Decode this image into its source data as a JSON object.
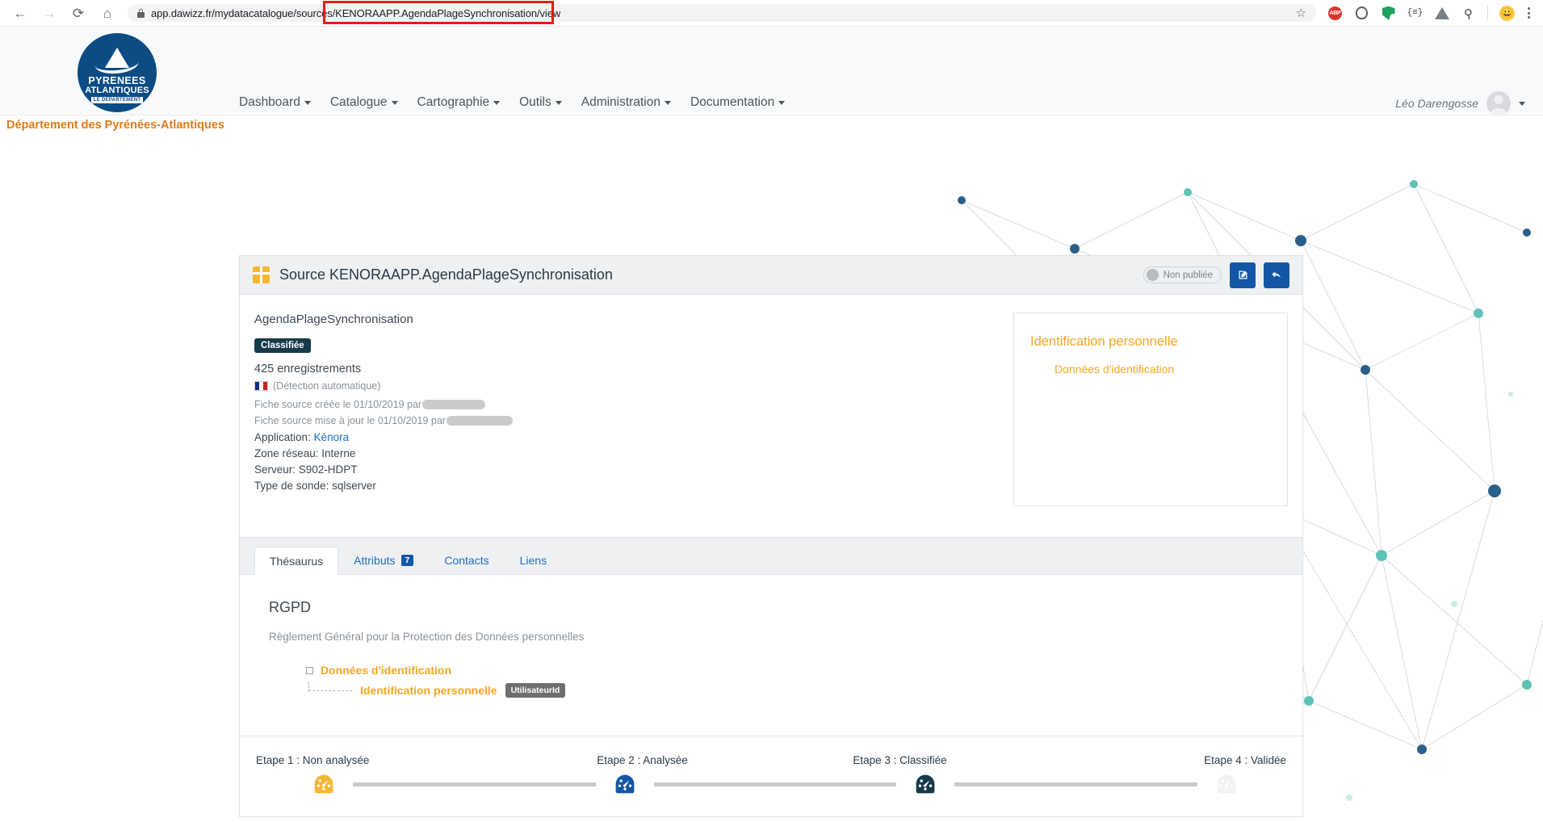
{
  "browser": {
    "back_icon": "arrow-left-icon",
    "forward_icon": "arrow-right-icon",
    "reload_icon": "reload-icon",
    "home_icon": "home-icon",
    "url_prefix": "app.dawizz.fr/mydatacatalogue/sourc",
    "url_highlight": "es/KENORAAPP.AgendaPlageSynchronisation/v",
    "url_suffix": "iew",
    "url_full": "app.dawizz.fr/mydatacatalogue/sources/KENORAAPP.AgendaPlageSynchronisation/view",
    "extensions": [
      "adblock-plus-icon",
      "ghostery-icon",
      "shield-check-icon",
      "json-viewer-icon",
      "drive-icon",
      "color-picker-icon",
      "profile-emoji-icon",
      "chrome-menu-icon"
    ],
    "bookmark_icon": "star-icon"
  },
  "header": {
    "logo": {
      "line1": "PYRENEES",
      "line2": "ATLANTIQUES",
      "line3": "LE DEPARTEMENT"
    },
    "department_name": "Département des Pyrénées-Atlantiques",
    "nav": [
      {
        "label": "Dashboard",
        "has_caret": true
      },
      {
        "label": "Catalogue",
        "has_caret": true
      },
      {
        "label": "Cartographie",
        "has_caret": true
      },
      {
        "label": "Outils",
        "has_caret": true
      },
      {
        "label": "Administration",
        "has_caret": true
      },
      {
        "label": "Documentation",
        "has_caret": true
      }
    ],
    "user": {
      "name": "Léo Darengosse",
      "avatar": "user-avatar-icon",
      "caret": "chevron-down-icon"
    }
  },
  "card": {
    "icon": "table-grid-icon",
    "title": "Source KENORAAPP.AgendaPlageSynchronisation",
    "publish_badge": "Non publiée",
    "edit_button": "✎",
    "back_button": "↩"
  },
  "info": {
    "source_name": "AgendaPlageSynchronisation",
    "classification_badge": "Classifiée",
    "record_count": "425 enregistrements",
    "language_note": "(Détection automatique)",
    "language_flag": "france-flag-icon",
    "created_label": "Fiche source créée le 01/10/2019 par",
    "updated_label": "Fiche source mise à jour le 01/10/2019 par",
    "redacted_author": "",
    "application_label": "Application:",
    "application_value": "Kénora",
    "network_zone": "Zone réseau: Interne",
    "server": "Serveur: S902-HDPT",
    "probe_type": "Type de sonde: sqlserver"
  },
  "side_panel": {
    "title": "Identification personnelle",
    "subtitle": "Données d'identification"
  },
  "tabs": [
    {
      "label": "Thésaurus",
      "badge": null,
      "active": true
    },
    {
      "label": "Attributs",
      "badge": "7",
      "active": false
    },
    {
      "label": "Contacts",
      "badge": null,
      "active": false
    },
    {
      "label": "Liens",
      "badge": null,
      "active": false
    }
  ],
  "rgpd": {
    "title": "RGPD",
    "subtitle": "Règlement Général pour la Protection des Données personnelles",
    "node_level1": "Données d'identification",
    "node_level2": "Identification personnelle",
    "chip": "UtilisateurId"
  },
  "stepper": {
    "steps": [
      {
        "label": "Etape 1 : Non analysée",
        "color": "#f7b733",
        "state": "done"
      },
      {
        "label": "Etape 2 : Analysée",
        "color": "#1257a5",
        "state": "done"
      },
      {
        "label": "Etape 3 : Classifiée",
        "color": "#173a4a",
        "state": "current"
      },
      {
        "label": "Etape 4 : Validée",
        "color": "#f1f2f3",
        "state": "pending"
      }
    ],
    "gauge_icon": "speedometer-icon"
  },
  "colors": {
    "brand_blue": "#0b4c85",
    "accent_orange": "#e07b18",
    "link_orange": "#f5a623",
    "button_blue": "#1257a5",
    "dark_teal": "#173a4a",
    "highlight_red": "#e41b17"
  }
}
